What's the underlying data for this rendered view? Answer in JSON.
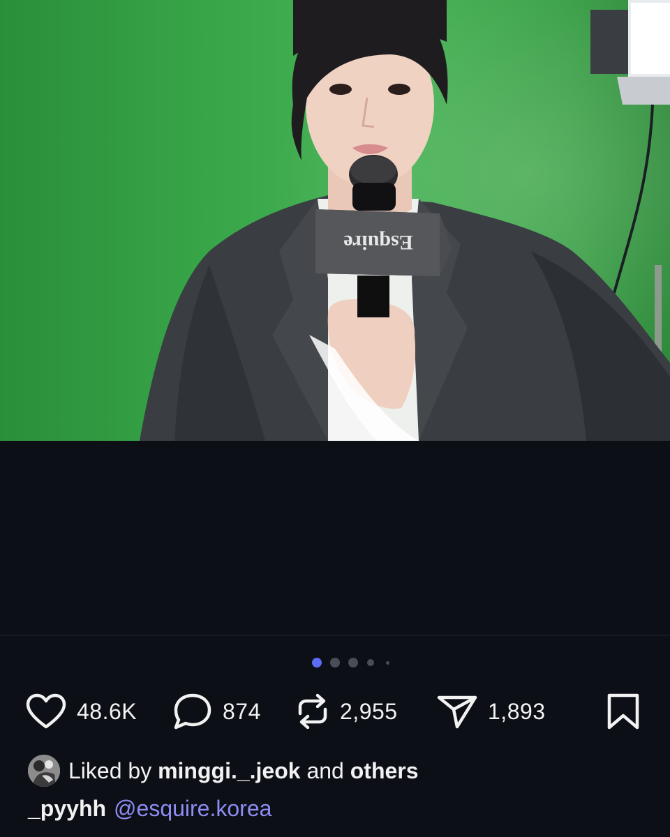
{
  "post": {
    "image": {
      "description_label": "Esquire",
      "background_color": "#3aa84a"
    },
    "carousel": {
      "total": 5,
      "active_index": 0,
      "active_color": "#5b6cf6"
    },
    "actions": {
      "likes": "48.6K",
      "comments": "874",
      "reposts": "2,955",
      "shares": "1,893"
    },
    "liked_by": {
      "prefix": "Liked by",
      "user": "minggi._.jeok",
      "connector": "and",
      "suffix": "others"
    },
    "caption": {
      "username": "_pyyhh",
      "mention": "@esquire.korea",
      "mention_color": "#8d8df2"
    },
    "icons": [
      "heart-icon",
      "comment-icon",
      "repost-icon",
      "send-icon",
      "bookmark-icon"
    ]
  }
}
